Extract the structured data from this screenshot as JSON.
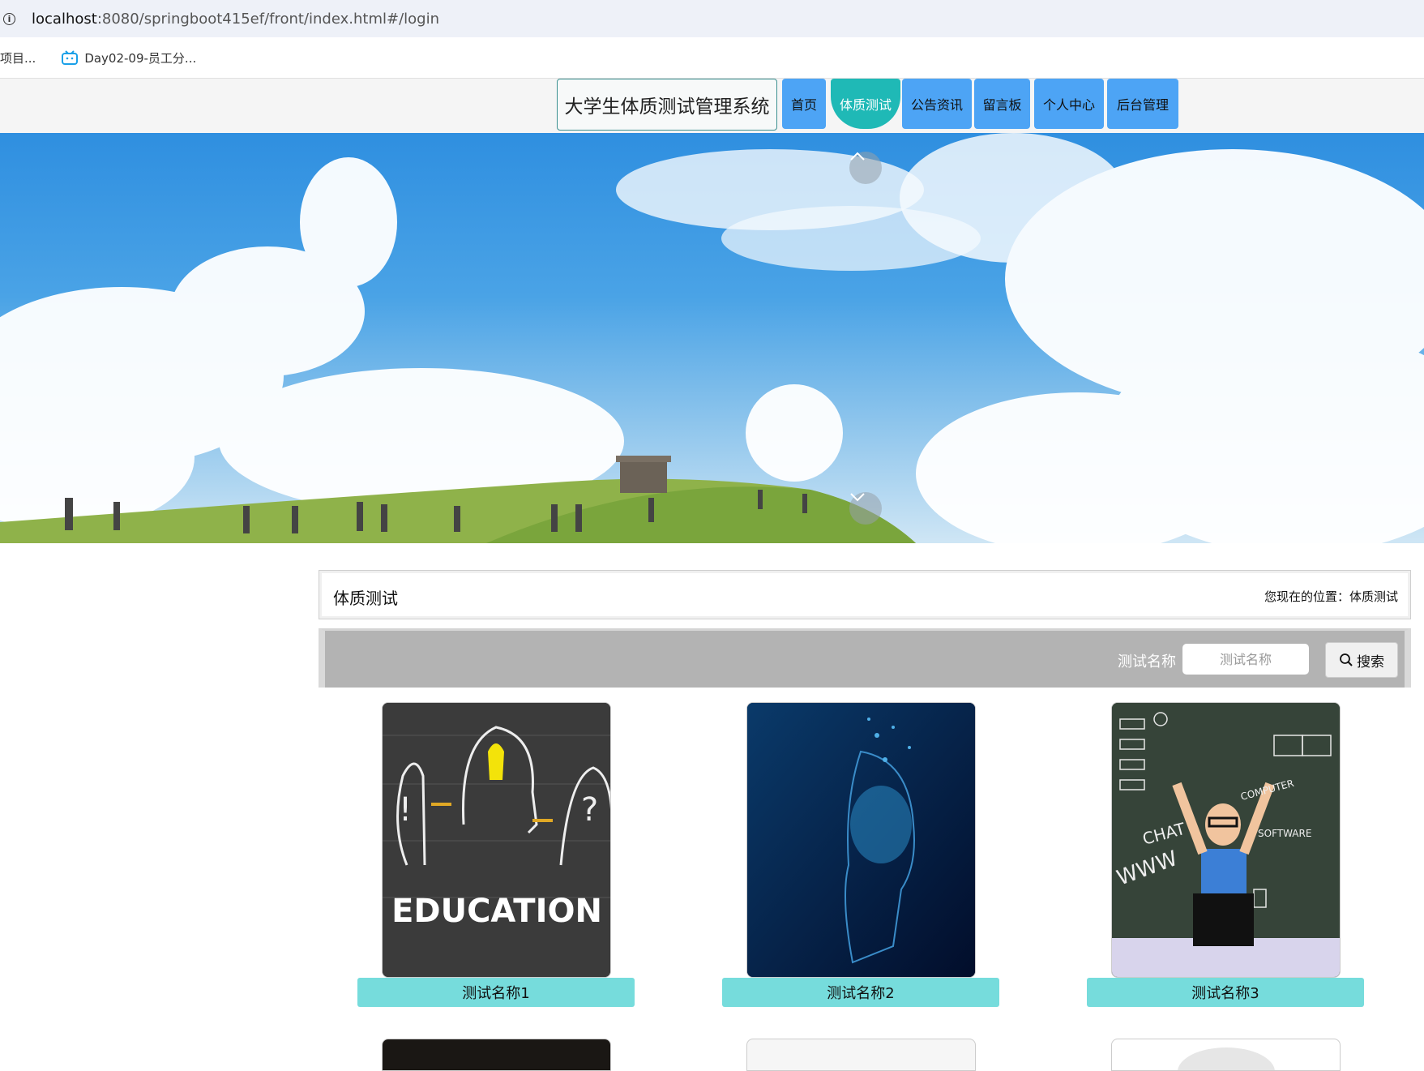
{
  "browser": {
    "url_host": "localhost",
    "url_path": ":8080/springboot415ef/front/index.html#/login",
    "bookmarks": [
      {
        "label": "项目..."
      },
      {
        "label": "Day02-09-员工分..."
      }
    ]
  },
  "nav": {
    "site_title": "大学生体质测试管理系统",
    "items": [
      {
        "label": "首页",
        "active": false
      },
      {
        "label": "体质测试",
        "active": true
      },
      {
        "label": "公告资讯",
        "active": false
      },
      {
        "label": "留言板",
        "active": false
      },
      {
        "label": "个人中心",
        "active": false
      },
      {
        "label": "后台管理",
        "active": false
      }
    ]
  },
  "breadcrumb": {
    "title": "体质测试",
    "location": "您现在的位置：体质测试"
  },
  "search": {
    "label": "测试名称",
    "placeholder": "测试名称",
    "button": "搜索"
  },
  "cards": [
    {
      "name": "测试名称1",
      "image": "education-chalkboard",
      "image_text": "EDUCATION"
    },
    {
      "name": "测试名称2",
      "image": "digital-head"
    },
    {
      "name": "测试名称3",
      "image": "computer-kid",
      "image_text": "CHAT WWW COMPUTER SOFTWARE PROGRAM LOADING"
    }
  ],
  "colors": {
    "nav_button": "#4da4f5",
    "nav_active": "#1fb9b6",
    "caption_bg": "#76dcdc",
    "search_bar": "#b3b3b3"
  }
}
